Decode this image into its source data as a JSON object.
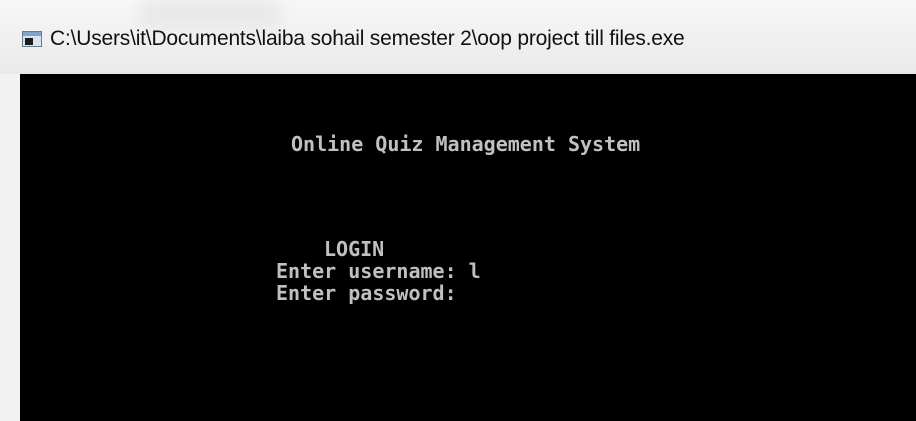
{
  "window": {
    "title": "C:\\Users\\it\\Documents\\laiba sohail semester 2\\oop project till files.exe",
    "icon": "console-app-icon"
  },
  "console": {
    "heading": "Online Quiz Management System",
    "login_label": "LOGIN",
    "username_prompt": "Enter username: ",
    "username_value": "l",
    "password_prompt": "Enter password: ",
    "password_value": ""
  },
  "colors": {
    "console_background": "#000000",
    "console_text": "#c0c0c0",
    "titlebar": "#f0f0f0"
  }
}
